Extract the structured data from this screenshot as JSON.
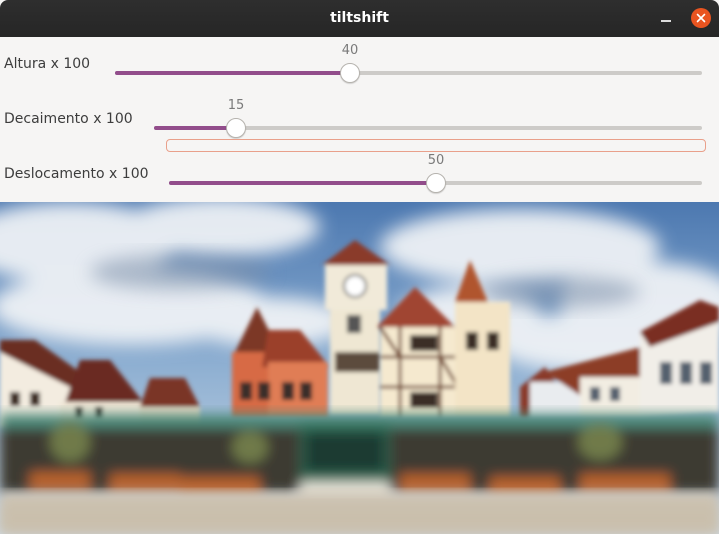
{
  "window": {
    "title": "tiltshift"
  },
  "sliders": [
    {
      "label": "Altura x 100",
      "value": "40",
      "fraction": 0.4
    },
    {
      "label": "Decaimento x 100",
      "value": "15",
      "fraction": 0.15
    },
    {
      "label": "Deslocamento x 100",
      "value": "50",
      "fraction": 0.5
    }
  ],
  "colors": {
    "accent": "#924d8b",
    "close": "#e95420",
    "titlebar": "#2c2c2c"
  },
  "icons": {
    "minimize": "minimize-icon",
    "close": "close-icon"
  }
}
